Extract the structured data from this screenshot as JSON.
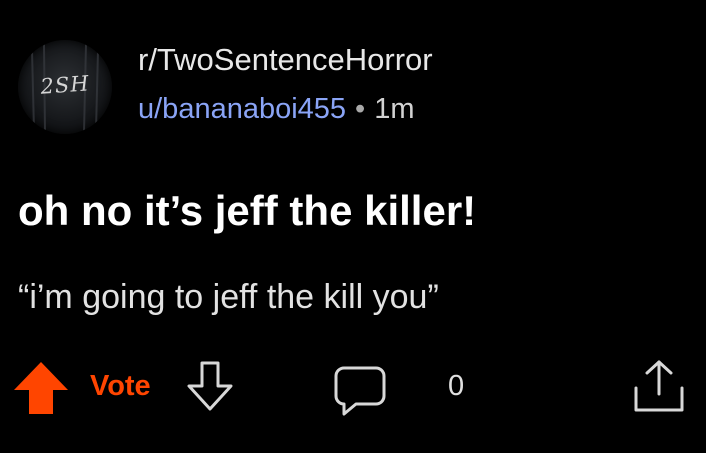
{
  "post": {
    "subreddit": "r/TwoSentenceHorror",
    "username": "u/bananaboi455",
    "separator": "•",
    "age": "1m",
    "title": "oh no it’s jeff the killer!",
    "body": "“i’m going to jeff the kill you”"
  },
  "avatar": {
    "text": "2SH"
  },
  "actions": {
    "vote_label": "Vote",
    "comment_count": "0",
    "upvote_icon": "arrow-up-icon",
    "downvote_icon": "arrow-down-icon",
    "comment_icon": "speech-bubble-icon",
    "share_icon": "share-upload-icon"
  },
  "colors": {
    "background": "#000000",
    "accent_upvote": "#ff4500",
    "username": "#8aa4f6",
    "text": "#ffffff"
  }
}
